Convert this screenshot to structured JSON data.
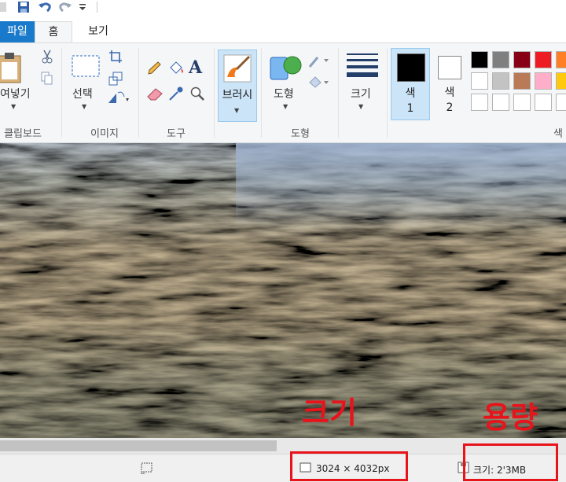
{
  "tabs": {
    "file": "파일",
    "home": "홈",
    "view": "보기"
  },
  "ribbon": {
    "clipboard": {
      "paste": "여넣기",
      "label": "클립보드"
    },
    "image": {
      "select": "선택",
      "label": "이미지"
    },
    "tools": {
      "label": "도구"
    },
    "brushes": {
      "label": "브러시"
    },
    "shapes": {
      "shapes_btn": "도형",
      "label": "도형"
    },
    "size": {
      "label": "크기"
    },
    "color1": {
      "line1": "색",
      "line2": "1"
    },
    "color2": {
      "line1": "색",
      "line2": "2"
    },
    "colors": {
      "label": "색"
    }
  },
  "palette": {
    "row1": [
      "#000000",
      "#7f7f7f",
      "#880015",
      "#ed1c24",
      "#ff7f27"
    ],
    "row2": [
      "#ffffff",
      "#c3c3c3",
      "#b97a57",
      "#ffaec9",
      "#ffc90e"
    ],
    "row3": [
      "#ffffff",
      "#ffffff",
      "#ffffff",
      "#ffffff",
      "#ffffff"
    ]
  },
  "status": {
    "dimensions": "3024 × 4032px",
    "filesize": "크기: 2'3MB"
  },
  "annotations": {
    "size_label": "크기",
    "capacity_label": "용량"
  },
  "colors": {
    "accent": "#1979ca",
    "highlight": "#e8131b"
  }
}
